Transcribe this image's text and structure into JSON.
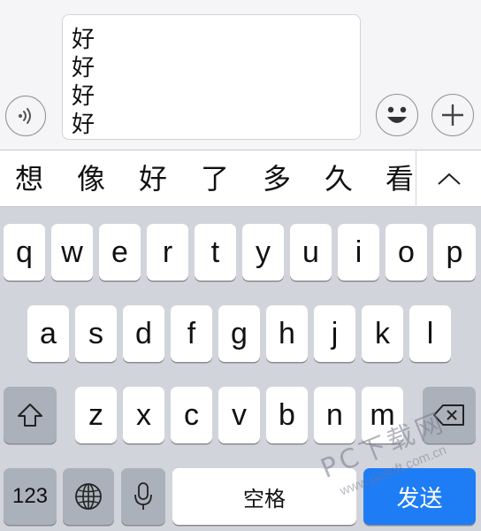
{
  "input": {
    "lines": [
      "好",
      "好",
      "好",
      "好"
    ]
  },
  "icons": {
    "voice": "voice-wave-icon",
    "emoji": "smiley-face-icon",
    "add": "plus-icon",
    "expand": "chevron-up-icon",
    "shift": "shift-arrow-icon",
    "delete": "backspace-icon",
    "globe": "globe-icon",
    "mic": "microphone-icon"
  },
  "candidates": [
    "想",
    "像",
    "好",
    "了",
    "多",
    "久",
    "看"
  ],
  "keyboard": {
    "row1": [
      "q",
      "w",
      "e",
      "r",
      "t",
      "y",
      "u",
      "i",
      "o",
      "p"
    ],
    "row2": [
      "a",
      "s",
      "d",
      "f",
      "g",
      "h",
      "j",
      "k",
      "l"
    ],
    "row3": [
      "z",
      "x",
      "c",
      "v",
      "b",
      "n",
      "m"
    ],
    "numbers_label": "123",
    "space_label": "空格",
    "send_label": "发送"
  },
  "watermark": {
    "main": "PC下载网",
    "sub": "www.pcsoft.com.cn"
  },
  "colors": {
    "send_key": "#1e7cf5",
    "keyboard_bg": "#d1d5db",
    "function_key": "#abb1ba"
  }
}
